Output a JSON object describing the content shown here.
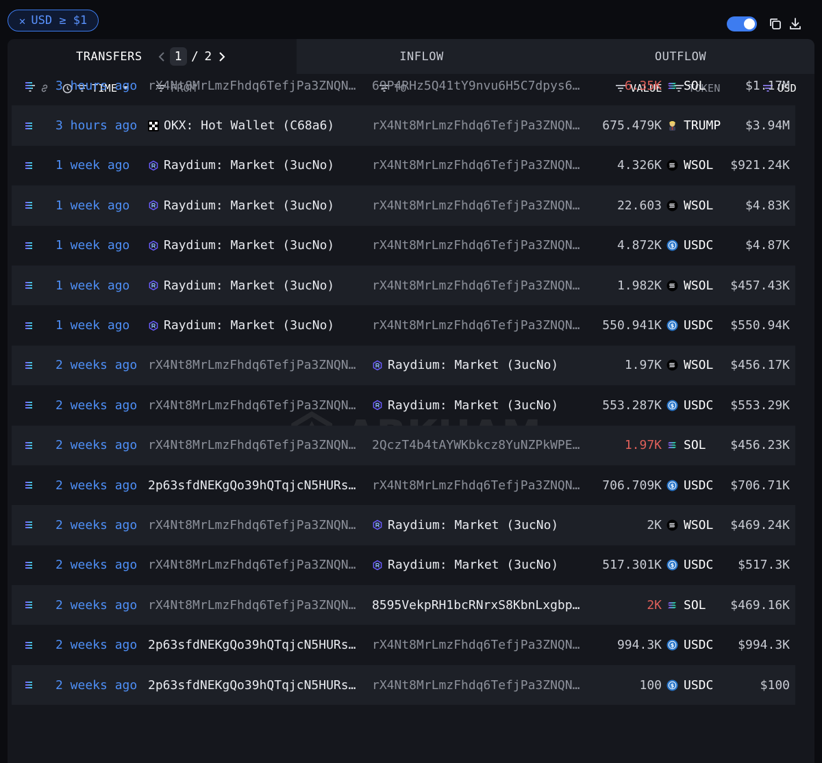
{
  "filter": {
    "label": "USD ≥ $1"
  },
  "tabs": {
    "transfers": "TRANSFERS",
    "inflow": "INFLOW",
    "outflow": "OUTFLOW",
    "page_current": "1",
    "page_sep": "/",
    "page_total": "2"
  },
  "columns": {
    "time": "TIME",
    "from": "FROM",
    "to": "TO",
    "value": "VALUE",
    "token": "TOKEN",
    "usd": "USD"
  },
  "watermark": "ARKHAM",
  "colors": {
    "accent": "#3d7cf0",
    "link": "#4e8ff7",
    "negative": "#e0605a",
    "panel": "#15171d",
    "row_alt": "#1d2027"
  },
  "rows": [
    {
      "time": "3 hours ago",
      "from": "rX4Nt8MrLmzFhdq6TefjPa3ZNQNu…",
      "from_type": "address",
      "to": "69P4RHz5Q41tY9nvu6H5C7dpys6n…",
      "to_type": "address",
      "value": "6.35K",
      "value_neg": true,
      "token": "SOL",
      "token_icon": "sol-icon",
      "usd": "$1.17M"
    },
    {
      "time": "3 hours ago",
      "from": "OKX: Hot Wallet (C68a6)",
      "from_type": "okx",
      "to": "rX4Nt8MrLmzFhdq6TefjPa3ZNQNu…",
      "to_type": "address",
      "value": "675.479K",
      "value_neg": false,
      "token": "TRUMP",
      "token_icon": "trump-icon",
      "usd": "$3.94M"
    },
    {
      "time": "1 week ago",
      "from": "Raydium: Market (3ucNo)",
      "from_type": "raydium",
      "to": "rX4Nt8MrLmzFhdq6TefjPa3ZNQNu…",
      "to_type": "address",
      "value": "4.326K",
      "value_neg": false,
      "token": "WSOL",
      "token_icon": "wsol-icon",
      "usd": "$921.24K"
    },
    {
      "time": "1 week ago",
      "from": "Raydium: Market (3ucNo)",
      "from_type": "raydium",
      "to": "rX4Nt8MrLmzFhdq6TefjPa3ZNQNu…",
      "to_type": "address",
      "value": "22.603",
      "value_neg": false,
      "token": "WSOL",
      "token_icon": "wsol-icon",
      "usd": "$4.83K"
    },
    {
      "time": "1 week ago",
      "from": "Raydium: Market (3ucNo)",
      "from_type": "raydium",
      "to": "rX4Nt8MrLmzFhdq6TefjPa3ZNQNu…",
      "to_type": "address",
      "value": "4.872K",
      "value_neg": false,
      "token": "USDC",
      "token_icon": "usdc-icon",
      "usd": "$4.87K"
    },
    {
      "time": "1 week ago",
      "from": "Raydium: Market (3ucNo)",
      "from_type": "raydium",
      "to": "rX4Nt8MrLmzFhdq6TefjPa3ZNQNu…",
      "to_type": "address",
      "value": "1.982K",
      "value_neg": false,
      "token": "WSOL",
      "token_icon": "wsol-icon",
      "usd": "$457.43K"
    },
    {
      "time": "1 week ago",
      "from": "Raydium: Market (3ucNo)",
      "from_type": "raydium",
      "to": "rX4Nt8MrLmzFhdq6TefjPa3ZNQNu…",
      "to_type": "address",
      "value": "550.941K",
      "value_neg": false,
      "token": "USDC",
      "token_icon": "usdc-icon",
      "usd": "$550.94K"
    },
    {
      "time": "2 weeks ago",
      "from": "rX4Nt8MrLmzFhdq6TefjPa3ZNQNu…",
      "from_type": "address",
      "to": "Raydium: Market (3ucNo)",
      "to_type": "raydium",
      "value": "1.97K",
      "value_neg": false,
      "token": "WSOL",
      "token_icon": "wsol-icon",
      "usd": "$456.17K"
    },
    {
      "time": "2 weeks ago",
      "from": "rX4Nt8MrLmzFhdq6TefjPa3ZNQNu…",
      "from_type": "address",
      "to": "Raydium: Market (3ucNo)",
      "to_type": "raydium",
      "value": "553.287K",
      "value_neg": false,
      "token": "USDC",
      "token_icon": "usdc-icon",
      "usd": "$553.29K"
    },
    {
      "time": "2 weeks ago",
      "from": "rX4Nt8MrLmzFhdq6TefjPa3ZNQNu…",
      "from_type": "address",
      "to": "2QczT4b4tAYWKbkcz8YuNZPkWPE4…",
      "to_type": "address",
      "value": "1.97K",
      "value_neg": true,
      "token": "SOL",
      "token_icon": "sol-icon",
      "usd": "$456.23K"
    },
    {
      "time": "2 weeks ago",
      "from": "2p63sfdNEKgQo39hQTqjcN5HURs9…",
      "from_type": "address-bright",
      "to": "rX4Nt8MrLmzFhdq6TefjPa3ZNQNu…",
      "to_type": "address",
      "value": "706.709K",
      "value_neg": false,
      "token": "USDC",
      "token_icon": "usdc-icon",
      "usd": "$706.71K"
    },
    {
      "time": "2 weeks ago",
      "from": "rX4Nt8MrLmzFhdq6TefjPa3ZNQNu…",
      "from_type": "address",
      "to": "Raydium: Market (3ucNo)",
      "to_type": "raydium",
      "value": "2K",
      "value_neg": false,
      "token": "WSOL",
      "token_icon": "wsol-icon",
      "usd": "$469.24K"
    },
    {
      "time": "2 weeks ago",
      "from": "rX4Nt8MrLmzFhdq6TefjPa3ZNQNu…",
      "from_type": "address",
      "to": "Raydium: Market (3ucNo)",
      "to_type": "raydium",
      "value": "517.301K",
      "value_neg": false,
      "token": "USDC",
      "token_icon": "usdc-icon",
      "usd": "$517.3K"
    },
    {
      "time": "2 weeks ago",
      "from": "rX4Nt8MrLmzFhdq6TefjPa3ZNQNu…",
      "from_type": "address",
      "to": "8595VekpRH1bcRNrxS8KbnLxgbpR…",
      "to_type": "address-bright",
      "value": "2K",
      "value_neg": true,
      "token": "SOL",
      "token_icon": "sol-icon",
      "usd": "$469.16K"
    },
    {
      "time": "2 weeks ago",
      "from": "2p63sfdNEKgQo39hQTqjcN5HURs9…",
      "from_type": "address-bright",
      "to": "rX4Nt8MrLmzFhdq6TefjPa3ZNQNu…",
      "to_type": "address",
      "value": "994.3K",
      "value_neg": false,
      "token": "USDC",
      "token_icon": "usdc-icon",
      "usd": "$994.3K"
    },
    {
      "time": "2 weeks ago",
      "from": "2p63sfdNEKgQo39hQTqjcN5HURs9…",
      "from_type": "address-bright",
      "to": "rX4Nt8MrLmzFhdq6TefjPa3ZNQNu…",
      "to_type": "address",
      "value": "100",
      "value_neg": false,
      "token": "USDC",
      "token_icon": "usdc-icon",
      "usd": "$100"
    }
  ]
}
